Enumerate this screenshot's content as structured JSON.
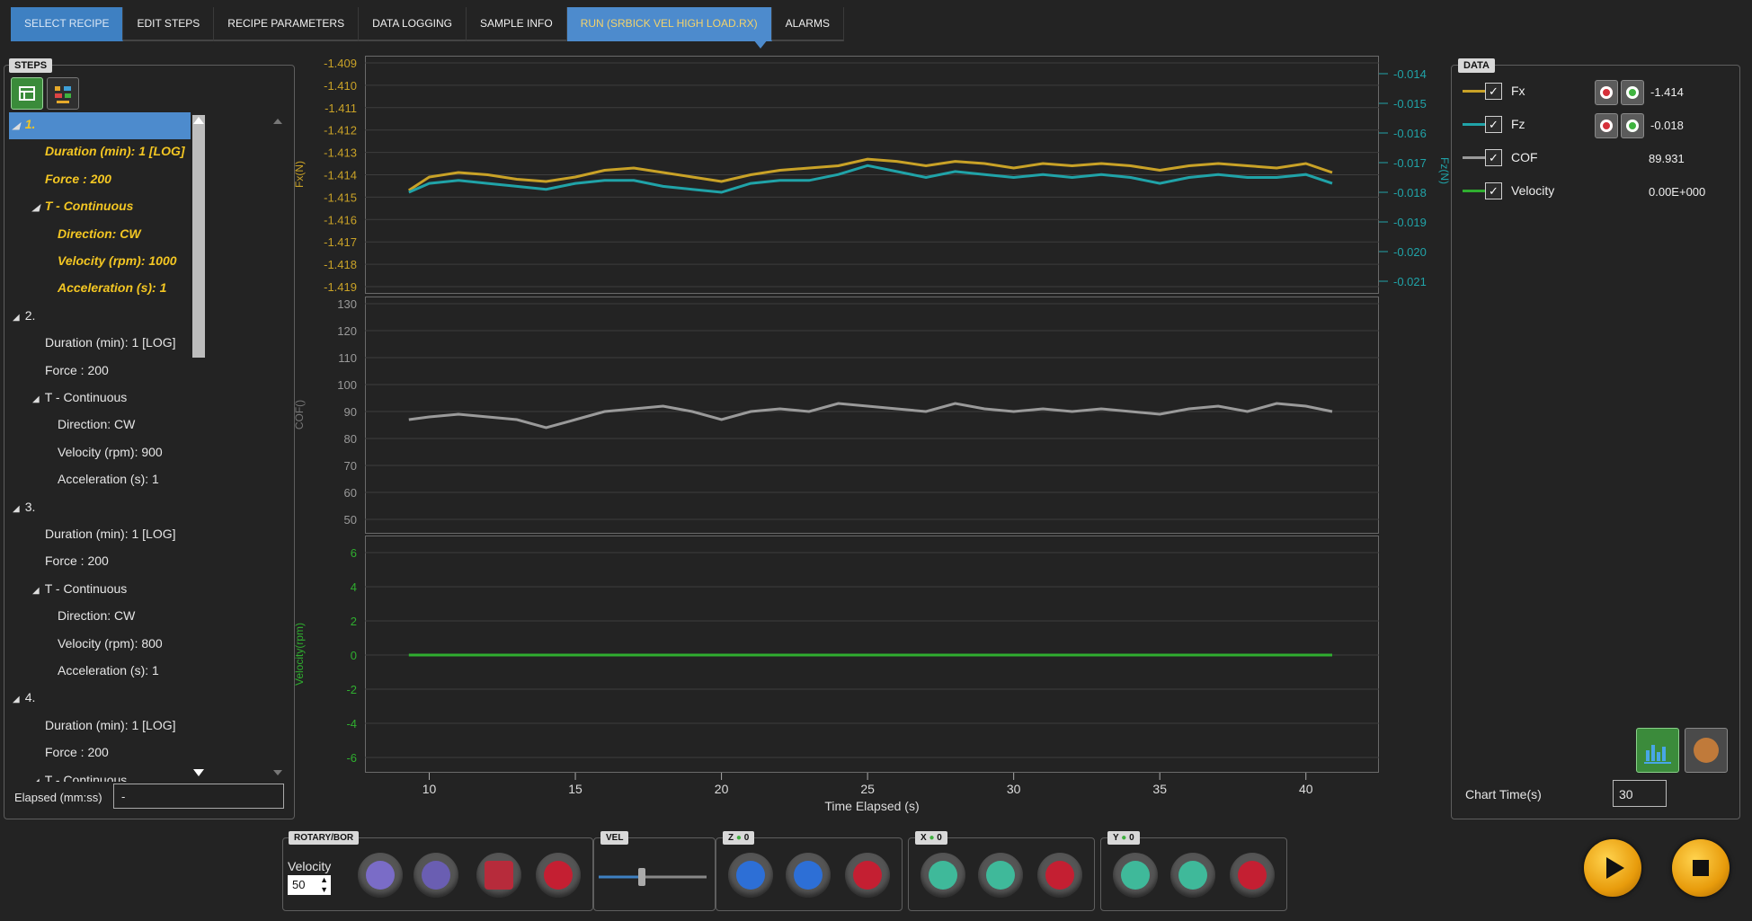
{
  "tabs": [
    {
      "label": "SELECT RECIPE",
      "state": "selected"
    },
    {
      "label": "EDIT STEPS",
      "state": ""
    },
    {
      "label": "RECIPE PARAMETERS",
      "state": ""
    },
    {
      "label": "DATA LOGGING",
      "state": ""
    },
    {
      "label": "SAMPLE INFO",
      "state": ""
    },
    {
      "label": "RUN (SRBICK VEL HIGH LOAD.RX)",
      "state": "active"
    },
    {
      "label": "ALARMS",
      "state": ""
    }
  ],
  "steps": {
    "label": "STEPS",
    "elapsed_label": "Elapsed (mm:ss)",
    "elapsed_value": "-",
    "items": [
      {
        "text": "1.",
        "level": 0,
        "arrow": true,
        "sel": true
      },
      {
        "text": "Duration (min): 1 [LOG]",
        "level": 1,
        "sel": true
      },
      {
        "text": "Force : 200",
        "level": 1,
        "sel": true
      },
      {
        "text": "T - Continuous",
        "level": 1,
        "arrow": true,
        "sel": true
      },
      {
        "text": "Direction: CW",
        "level": 2,
        "sel": true
      },
      {
        "text": "Velocity (rpm): 1000",
        "level": 2,
        "sel": true
      },
      {
        "text": "Acceleration (s): 1",
        "level": 2,
        "sel": true
      },
      {
        "text": "2.",
        "level": 0,
        "arrow": true
      },
      {
        "text": "Duration (min): 1 [LOG]",
        "level": 1
      },
      {
        "text": "Force : 200",
        "level": 1
      },
      {
        "text": "T - Continuous",
        "level": 1,
        "arrow": true
      },
      {
        "text": "Direction: CW",
        "level": 2
      },
      {
        "text": "Velocity (rpm): 900",
        "level": 2
      },
      {
        "text": "Acceleration (s): 1",
        "level": 2
      },
      {
        "text": "3.",
        "level": 0,
        "arrow": true
      },
      {
        "text": "Duration (min): 1 [LOG]",
        "level": 1
      },
      {
        "text": "Force : 200",
        "level": 1
      },
      {
        "text": "T - Continuous",
        "level": 1,
        "arrow": true
      },
      {
        "text": "Direction: CW",
        "level": 2
      },
      {
        "text": "Velocity (rpm): 800",
        "level": 2
      },
      {
        "text": "Acceleration (s): 1",
        "level": 2
      },
      {
        "text": "4.",
        "level": 0,
        "arrow": true
      },
      {
        "text": "Duration (min): 1 [LOG]",
        "level": 1
      },
      {
        "text": "Force : 200",
        "level": 1
      },
      {
        "text": "T - Continuous",
        "level": 1,
        "arrow": true
      }
    ]
  },
  "data_panel": {
    "label": "DATA",
    "rows": [
      {
        "name": "Fx",
        "value": "-1.414",
        "color": "#c9a227",
        "checked": true
      },
      {
        "name": "Fz",
        "value": "-0.018",
        "color": "#20a3a8",
        "checked": true
      },
      {
        "name": "COF",
        "value": "89.931",
        "color": "#9a9a9a",
        "checked": true
      },
      {
        "name": "Velocity",
        "value": "0.00E+000",
        "color": "#2fae2f",
        "checked": true
      }
    ],
    "chart_time_label": "Chart Time(s)",
    "chart_time_value": "30"
  },
  "controls": {
    "rotary_label": "ROTARY/BOR",
    "velocity_label": "Velocity",
    "velocity_value": "50",
    "vel_label": "VEL",
    "vel_slider_level": 0.4,
    "z_label": "Z",
    "z_value": "0",
    "x_label": "X",
    "x_value": "0",
    "y_label": "Y",
    "y_value": "0"
  },
  "chart_data": [
    {
      "type": "line",
      "ylabel": "Fx(N)",
      "y2label": "Fz(N)",
      "yticks": [
        "-1.409",
        "-1.410",
        "-1.411",
        "-1.412",
        "-1.413",
        "-1.414",
        "-1.415",
        "-1.416",
        "-1.417",
        "-1.418",
        "-1.419"
      ],
      "y2ticks": [
        "-0.014",
        "-0.015",
        "-0.016",
        "-0.017",
        "-0.018",
        "-0.019",
        "-0.020",
        "-0.021"
      ],
      "ylim": [
        -1.419,
        -1.409
      ],
      "y2lim": [
        -0.021,
        -0.014
      ],
      "series": [
        {
          "name": "Fx",
          "color": "#c9a227",
          "axis": "left",
          "x": [
            9.3,
            10,
            11,
            12,
            13,
            14,
            15,
            16,
            17,
            18,
            19,
            20,
            21,
            22,
            23,
            24,
            25,
            26,
            27,
            28,
            29,
            30,
            31,
            32,
            33,
            34,
            35,
            36,
            37,
            38,
            39,
            40,
            40.9
          ],
          "y": [
            -1.4147,
            -1.4141,
            -1.4139,
            -1.414,
            -1.4142,
            -1.4143,
            -1.4141,
            -1.4138,
            -1.4137,
            -1.4139,
            -1.4141,
            -1.4143,
            -1.414,
            -1.4138,
            -1.4137,
            -1.4136,
            -1.4133,
            -1.4134,
            -1.4136,
            -1.4134,
            -1.4135,
            -1.4137,
            -1.4135,
            -1.4136,
            -1.4135,
            -1.4136,
            -1.4138,
            -1.4136,
            -1.4135,
            -1.4136,
            -1.4137,
            -1.4135,
            -1.4139
          ]
        },
        {
          "name": "Fz",
          "color": "#20a3a8",
          "axis": "right",
          "x": [
            9.3,
            10,
            11,
            12,
            13,
            14,
            15,
            16,
            17,
            18,
            19,
            20,
            21,
            22,
            23,
            24,
            25,
            26,
            27,
            28,
            29,
            30,
            31,
            32,
            33,
            34,
            35,
            36,
            37,
            38,
            39,
            40,
            40.9
          ],
          "y": [
            -0.018,
            -0.0177,
            -0.0176,
            -0.0177,
            -0.0178,
            -0.0179,
            -0.0177,
            -0.0176,
            -0.0176,
            -0.0178,
            -0.0179,
            -0.018,
            -0.0177,
            -0.0176,
            -0.0176,
            -0.0174,
            -0.0171,
            -0.0173,
            -0.0175,
            -0.0173,
            -0.0174,
            -0.0175,
            -0.0174,
            -0.0175,
            -0.0174,
            -0.0175,
            -0.0177,
            -0.0175,
            -0.0174,
            -0.0175,
            -0.0175,
            -0.0174,
            -0.0177
          ]
        }
      ]
    },
    {
      "type": "line",
      "ylabel": "COF()",
      "yticks": [
        "130",
        "120",
        "110",
        "100",
        "90",
        "80",
        "70",
        "60",
        "50"
      ],
      "ylim": [
        46,
        130
      ],
      "series": [
        {
          "name": "COF",
          "color": "#9a9a9a",
          "x": [
            9.3,
            10,
            11,
            12,
            13,
            14,
            15,
            16,
            17,
            18,
            19,
            20,
            21,
            22,
            23,
            24,
            25,
            26,
            27,
            28,
            29,
            30,
            31,
            32,
            33,
            34,
            35,
            36,
            37,
            38,
            39,
            40,
            40.9
          ],
          "y": [
            87,
            88,
            89,
            88,
            87,
            84,
            87,
            90,
            91,
            92,
            90,
            87,
            90,
            91,
            90,
            93,
            92,
            91,
            90,
            93,
            91,
            90,
            91,
            90,
            91,
            90,
            89,
            91,
            92,
            90,
            93,
            92,
            90
          ]
        }
      ]
    },
    {
      "type": "line",
      "ylabel": "Velocity(rpm)",
      "xlabel": "Time Elapsed (s)",
      "xticks": [
        "10",
        "15",
        "20",
        "25",
        "30",
        "35",
        "40"
      ],
      "xlim": [
        7.8,
        42.5
      ],
      "yticks": [
        "6",
        "4",
        "2",
        "0",
        "-2",
        "-4",
        "-6"
      ],
      "ylim": [
        -7,
        7
      ],
      "series": [
        {
          "name": "Velocity",
          "color": "#2fae2f",
          "x": [
            9.3,
            40.9
          ],
          "y": [
            0,
            0
          ]
        }
      ]
    }
  ]
}
